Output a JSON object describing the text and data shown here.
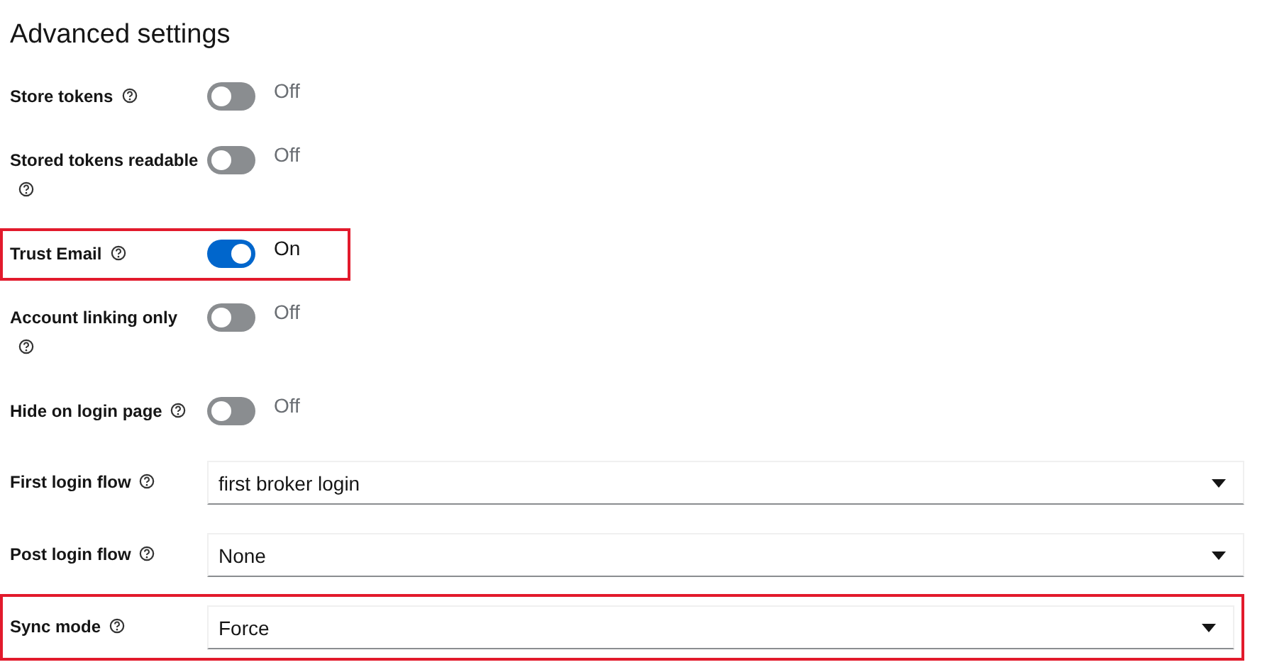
{
  "title": "Advanced settings",
  "rows": [
    {
      "kind": "toggle",
      "label": "Store tokens",
      "on": false,
      "state_text": "Off",
      "highlighted": false
    },
    {
      "kind": "toggle",
      "label": "Stored tokens readable",
      "on": false,
      "state_text": "Off",
      "highlighted": false
    },
    {
      "kind": "toggle",
      "label": "Trust Email",
      "on": true,
      "state_text": "On",
      "highlighted": true
    },
    {
      "kind": "toggle",
      "label": "Account linking only",
      "on": false,
      "state_text": "Off",
      "highlighted": false
    },
    {
      "kind": "toggle",
      "label": "Hide on login page",
      "on": false,
      "state_text": "Off",
      "highlighted": false
    },
    {
      "kind": "select",
      "label": "First login flow",
      "value": "first broker login",
      "highlighted": false
    },
    {
      "kind": "select",
      "label": "Post login flow",
      "value": "None",
      "highlighted": false
    },
    {
      "kind": "select",
      "label": "Sync mode",
      "value": "Force",
      "highlighted": true
    }
  ]
}
